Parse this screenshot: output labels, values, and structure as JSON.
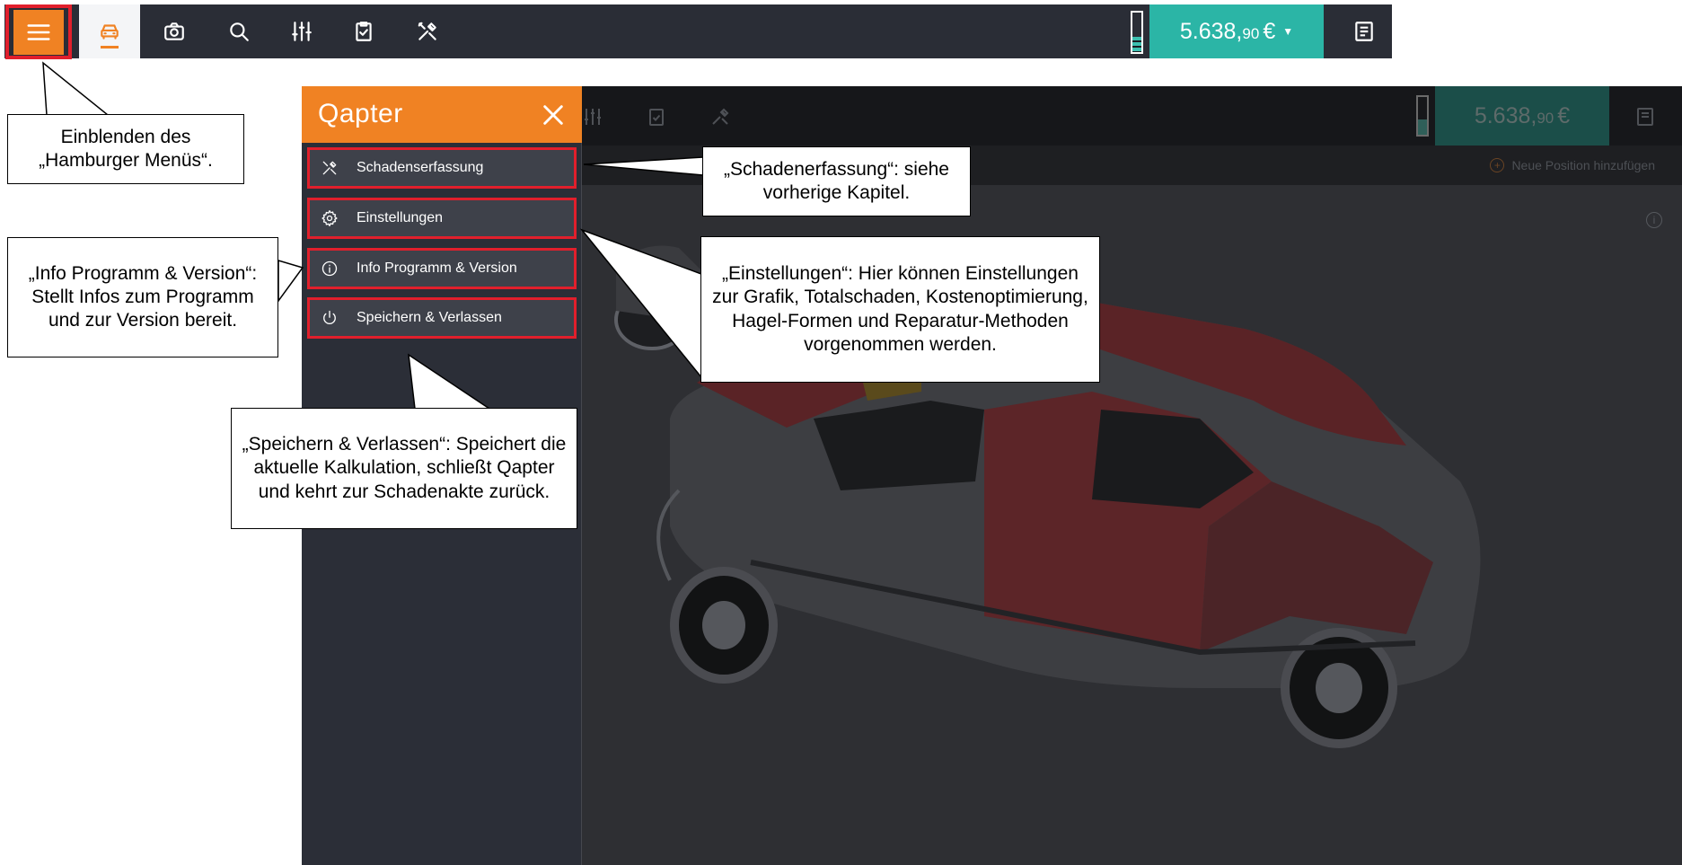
{
  "toolbar": {
    "icons": [
      "hamburger-icon",
      "car-icon",
      "camera-icon",
      "search-icon",
      "sliders-icon",
      "clipboard-check-icon",
      "tools-icon"
    ],
    "price_main": "5.638,",
    "price_cents": "90",
    "price_currency": "€",
    "level_fraction": 0.38
  },
  "background_app": {
    "price_main": "5.638,",
    "price_cents": "90",
    "price_currency": "€",
    "add_position_label": "Neue Position hinzufügen"
  },
  "side_menu": {
    "logo": "Qapter",
    "items": [
      {
        "label": "Schadenserfassung",
        "icon": "tools-icon"
      },
      {
        "label": "Einstellungen",
        "icon": "gear-icon"
      },
      {
        "label": "Info Programm & Version",
        "icon": "info-icon"
      },
      {
        "label": "Speichern & Verlassen",
        "icon": "power-icon"
      }
    ]
  },
  "callouts": {
    "hamburger": "Einblenden des „Hamburger Menüs“.",
    "schadenerfassung": "„Schadenerfassung“: siehe vorherige Kapitel.",
    "einstellungen": "„Einstellungen“: Hier können Einstellungen zur Grafik, Totalschaden, Kostenoptimierung, Hagel-Formen und Reparatur-Methoden vorgenommen werden.",
    "info": "„Info Programm & Version“: Stellt Infos zum Programm und zur Version bereit.",
    "speichern": "„Speichern & Verlassen“: Speichert die aktuelle Kalkulation, schließt Qapter und kehrt zur Schadenakte zurück."
  },
  "colors": {
    "accent_orange": "#f08223",
    "price_teal": "#2bb5a6",
    "toolbar_dark": "#2a2d36",
    "highlight_red": "#e11f2c",
    "damage_red": "#8b1f24"
  }
}
